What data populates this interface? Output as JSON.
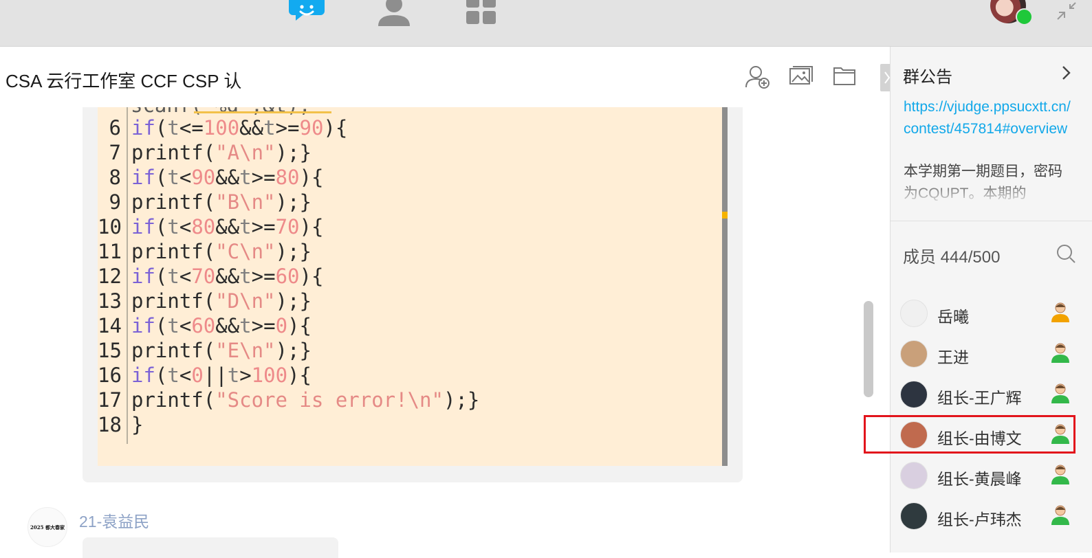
{
  "topbar": {
    "icons": [
      "chat-bubble-icon",
      "contacts-icon",
      "apps-grid-icon"
    ],
    "status_color": "#1fc83a"
  },
  "chat": {
    "title": "CSA 云行工作室 CCF CSP 认",
    "header_icons": [
      "add-member-icon",
      "image-icon",
      "folder-icon"
    ],
    "code_lines": [
      {
        "n": "6",
        "tokens": [
          [
            "kw",
            "if"
          ],
          [
            "",
            "("
          ],
          [
            "var",
            "t"
          ],
          [
            "",
            "<="
          ],
          [
            "num",
            "100"
          ],
          [
            "",
            "&&"
          ],
          [
            "var",
            "t"
          ],
          [
            "",
            ">="
          ],
          [
            "num",
            "90"
          ],
          [
            "",
            "){"
          ]
        ]
      },
      {
        "n": "7",
        "tokens": [
          [
            "",
            "printf("
          ],
          [
            "str",
            "\"A\\n\""
          ],
          [
            "",
            ");}"
          ]
        ]
      },
      {
        "n": "8",
        "tokens": [
          [
            "kw",
            "if"
          ],
          [
            "",
            "("
          ],
          [
            "var",
            "t"
          ],
          [
            "",
            "<"
          ],
          [
            "num",
            "90"
          ],
          [
            "",
            "&&"
          ],
          [
            "var",
            "t"
          ],
          [
            "",
            ">="
          ],
          [
            "num",
            "80"
          ],
          [
            "",
            "){"
          ]
        ]
      },
      {
        "n": "9",
        "tokens": [
          [
            "",
            "printf("
          ],
          [
            "str",
            "\"B\\n\""
          ],
          [
            "",
            ");}"
          ]
        ]
      },
      {
        "n": "10",
        "tokens": [
          [
            "kw",
            "if"
          ],
          [
            "",
            "("
          ],
          [
            "var",
            "t"
          ],
          [
            "",
            "<"
          ],
          [
            "num",
            "80"
          ],
          [
            "",
            "&&"
          ],
          [
            "var",
            "t"
          ],
          [
            "",
            ">="
          ],
          [
            "num",
            "70"
          ],
          [
            "",
            "){"
          ]
        ]
      },
      {
        "n": "11",
        "tokens": [
          [
            "",
            "printf("
          ],
          [
            "str",
            "\"C\\n\""
          ],
          [
            "",
            ");}"
          ]
        ]
      },
      {
        "n": "12",
        "tokens": [
          [
            "kw",
            "if"
          ],
          [
            "",
            "("
          ],
          [
            "var",
            "t"
          ],
          [
            "",
            "<"
          ],
          [
            "num",
            "70"
          ],
          [
            "",
            "&&"
          ],
          [
            "var",
            "t"
          ],
          [
            "",
            ">="
          ],
          [
            "num",
            "60"
          ],
          [
            "",
            "){"
          ]
        ]
      },
      {
        "n": "13",
        "tokens": [
          [
            "",
            "printf("
          ],
          [
            "str",
            "\"D\\n\""
          ],
          [
            "",
            ");}"
          ]
        ]
      },
      {
        "n": "14",
        "tokens": [
          [
            "kw",
            "if"
          ],
          [
            "",
            "("
          ],
          [
            "var",
            "t"
          ],
          [
            "",
            "<"
          ],
          [
            "num",
            "60"
          ],
          [
            "",
            "&&"
          ],
          [
            "var",
            "t"
          ],
          [
            "",
            ">="
          ],
          [
            "num",
            "0"
          ],
          [
            "",
            "){"
          ]
        ]
      },
      {
        "n": "15",
        "tokens": [
          [
            "",
            "printf("
          ],
          [
            "str",
            "\"E\\n\""
          ],
          [
            "",
            ");}"
          ]
        ]
      },
      {
        "n": "16",
        "tokens": [
          [
            "kw",
            "if"
          ],
          [
            "",
            "("
          ],
          [
            "var",
            "t"
          ],
          [
            "",
            "<"
          ],
          [
            "num",
            "0"
          ],
          [
            "",
            "||"
          ],
          [
            "var",
            "t"
          ],
          [
            "",
            ">"
          ],
          [
            "num",
            "100"
          ],
          [
            "",
            "){"
          ]
        ]
      },
      {
        "n": "17",
        "tokens": [
          [
            "",
            "printf("
          ],
          [
            "str",
            "\"Score is error!\\n\""
          ],
          [
            "",
            ");}"
          ]
        ]
      },
      {
        "n": "18",
        "tokens": [
          [
            "",
            "}"
          ]
        ]
      }
    ],
    "sender": {
      "name": "21-袁益民",
      "avatar_text": "2025 都大春家"
    }
  },
  "panel": {
    "notice_title": "群公告",
    "notice_link": "https://vjudge.ppsucxtt.cn/contest/457814#overview",
    "notice_text": "本学期第一期题目，密码为CQUPT。本期的",
    "members_title": "成员 444/500",
    "members": [
      {
        "name": "岳曦",
        "role_color": "#f2a200",
        "avatar": "#f0f0f0"
      },
      {
        "name": "王进",
        "role_color": "#33b84a",
        "avatar": "#c9a07a"
      },
      {
        "name": "组长-王广辉",
        "role_color": "#33b84a",
        "avatar": "#2d3440"
      },
      {
        "name": "组长-由博文",
        "role_color": "#33b84a",
        "avatar": "#c06a4e"
      },
      {
        "name": "组长-黄晨峰",
        "role_color": "#33b84a",
        "avatar": "#d9cfe0"
      },
      {
        "name": "组长-卢玮杰",
        "role_color": "#33b84a",
        "avatar": "#2f3a3e"
      }
    ],
    "highlighted_member": "组长-由博文"
  },
  "colors": {
    "link": "#12a8e9",
    "highlight": "#e2141c",
    "code_bg": "#ffeed6"
  }
}
